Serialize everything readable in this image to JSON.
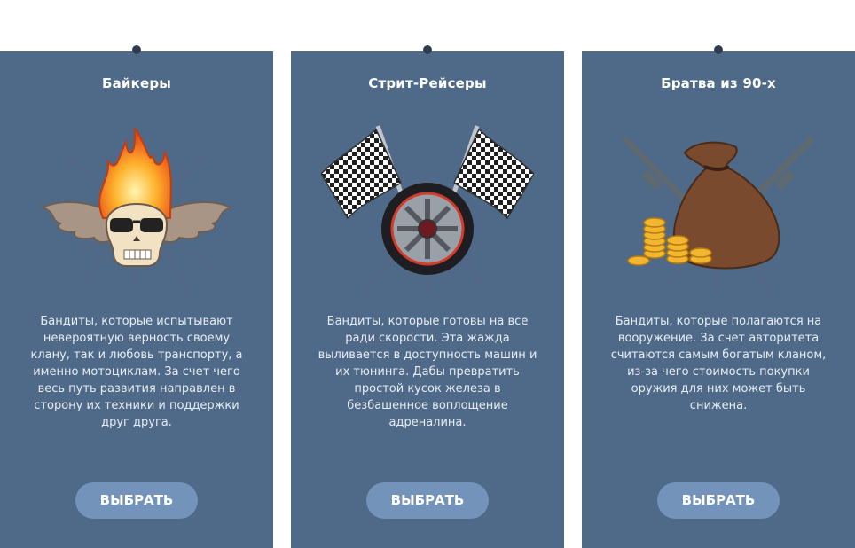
{
  "cards": [
    {
      "title": "Байкеры",
      "icon": "flaming-winged-skull-icon",
      "description": "Бандиты, которые испытывают невероятную верность своему клану, так и любовь транспорту, а именно мотоциклам. За счет чего весь путь развития направлен в сторону их техники и поддержки друг друга.",
      "button": "ВЫБРАТЬ"
    },
    {
      "title": "Стрит-Рейсеры",
      "icon": "checkered-flags-wheel-icon",
      "description": "Бандиты, которые готовы на все ради скорости. Эта жажда выливается в доступность машин и их тюнинга. Дабы превратить простой кусок железа в безбашенное воплощение адреналина.",
      "button": "ВЫБРАТЬ"
    },
    {
      "title": "Братва из 90-х",
      "icon": "money-bag-rifles-icon",
      "description": "Бандиты, которые полагаются на вооружение. За счет авторитета считаются самым богатым кланом, из-за чего стоимость покупки оружия для них может быть снижена.",
      "button": "ВЫБРАТЬ"
    }
  ],
  "colors": {
    "card_background": "#4e6a88",
    "button_background": "#7393ba"
  }
}
